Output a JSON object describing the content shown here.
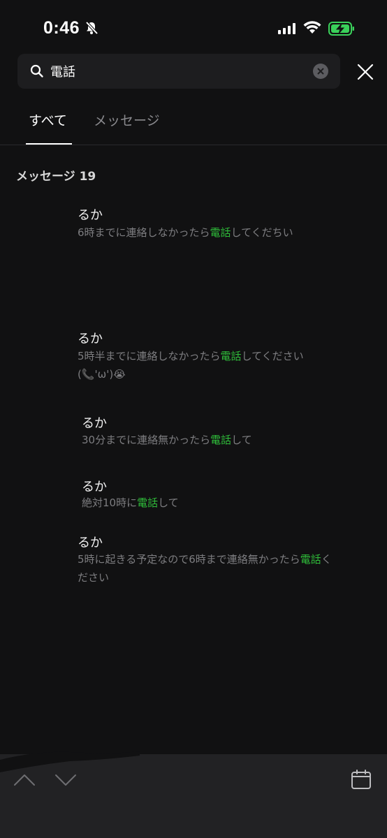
{
  "status_bar": {
    "time": "0:46",
    "icons": [
      "bell-slash-icon",
      "signal-icon",
      "wifi-icon",
      "battery-charging-icon"
    ],
    "battery_color": "#3ad05a"
  },
  "search": {
    "value": "電話",
    "icons": [
      "search-icon",
      "clear-icon",
      "close-icon"
    ]
  },
  "tabs": [
    {
      "label": "すべて",
      "active": true
    },
    {
      "label": "メッセージ",
      "active": false
    }
  ],
  "section": {
    "title": "メッセージ 19"
  },
  "colors": {
    "background": "#111112",
    "highlight": "#2fbd3a",
    "muted_text": "#7d7d80"
  },
  "results": [
    {
      "sender": "るか",
      "pre": "6時までに連絡しなかったら",
      "highlight": "電話",
      "post": "してくだちい"
    },
    {
      "sender": "るか",
      "pre": "5時半までに連絡しなかったら",
      "highlight": "電話",
      "post": "してください(📞'ω')😭"
    },
    {
      "sender": "るか",
      "pre": "30分までに連絡無かったら",
      "highlight": "電話",
      "post": "して"
    },
    {
      "sender": "るか",
      "pre": "絶対10時に",
      "highlight": "電話",
      "post": "して"
    },
    {
      "sender": "るか",
      "pre": "5時に起きる予定なので6時まで連絡無かったら",
      "highlight": "電話",
      "post": "ください"
    }
  ],
  "bottom_bar": {
    "icons": [
      "chevron-up-icon",
      "chevron-down-icon",
      "calendar-icon"
    ]
  }
}
